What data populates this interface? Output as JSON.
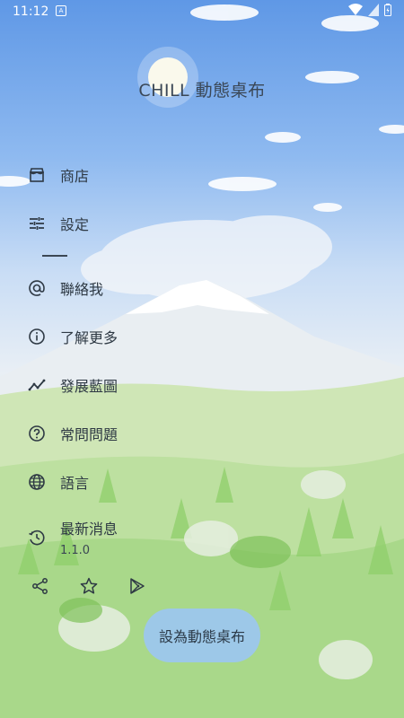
{
  "status_bar": {
    "time": "11:12",
    "notification_icon": "a-icon"
  },
  "app_title": "CHILL 動態桌布",
  "menu": [
    {
      "label": "商店",
      "icon": "store-icon"
    },
    {
      "label": "設定",
      "icon": "tune-icon"
    },
    {
      "label": "聯絡我",
      "icon": "at-icon"
    },
    {
      "label": "了解更多",
      "icon": "info-icon"
    },
    {
      "label": "發展藍圖",
      "icon": "trending-icon"
    },
    {
      "label": "常問問題",
      "icon": "help-icon"
    },
    {
      "label": "語言",
      "icon": "globe-icon"
    }
  ],
  "news": {
    "label": "最新消息",
    "version": "1.1.0",
    "icon": "history-icon"
  },
  "bottom_icons": [
    "share-icon",
    "star-icon",
    "play-store-icon"
  ],
  "primary_button": {
    "label": "設為動態桌布"
  },
  "colors": {
    "text": "#2e3944",
    "button": "#9dc8e8",
    "sky_top": "#5f98e6",
    "meadow": "#a9d88a"
  }
}
